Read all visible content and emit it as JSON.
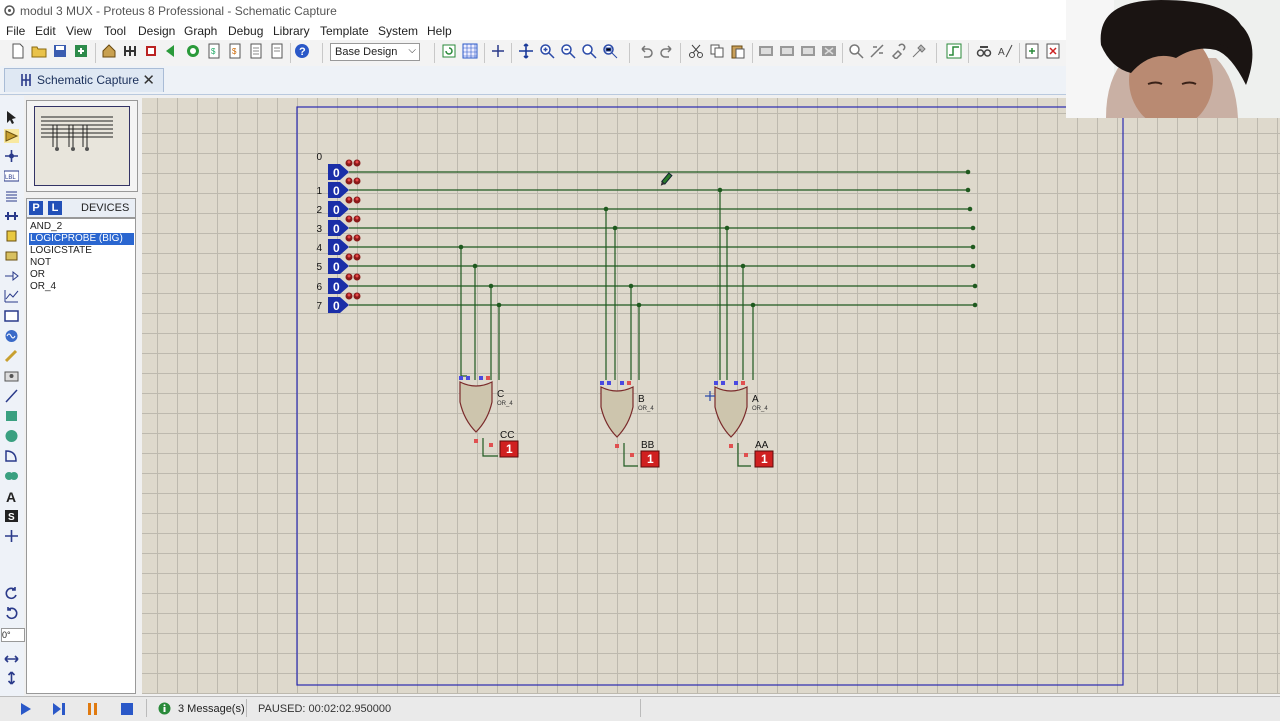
{
  "window": {
    "title": "modul 3 MUX - Proteus 8 Professional - Schematic Capture"
  },
  "menu": [
    "File",
    "Edit",
    "View",
    "Tool",
    "Design",
    "Graph",
    "Debug",
    "Library",
    "Template",
    "System",
    "Help"
  ],
  "toolbar": {
    "design_select": "Base Design"
  },
  "tab": {
    "label": "Schematic Capture",
    "close": "✕"
  },
  "panel": {
    "p_button": "P",
    "l_button": "L",
    "header": "DEVICES",
    "devices": [
      "AND_2",
      "LOGICPROBE (BIG)",
      "LOGICSTATE",
      "NOT",
      "OR",
      "OR_4"
    ],
    "selected_device": "LOGICPROBE (BIG)"
  },
  "rotation": "0°",
  "schematic": {
    "inputs": [
      {
        "label": "0",
        "state": "0"
      },
      {
        "label": "1",
        "state": "0"
      },
      {
        "label": "2",
        "state": "0"
      },
      {
        "label": "3",
        "state": "0"
      },
      {
        "label": "4",
        "state": "0"
      },
      {
        "label": "5",
        "state": "0"
      },
      {
        "label": "6",
        "state": "0"
      },
      {
        "label": "7",
        "state": "0"
      }
    ],
    "gates": [
      {
        "name": "C",
        "type": "OR_4",
        "probe": "CC",
        "value": "1"
      },
      {
        "name": "B",
        "type": "OR_4",
        "probe": "BB",
        "value": "1"
      },
      {
        "name": "A",
        "type": "OR_4",
        "probe": "AA",
        "value": "1"
      }
    ]
  },
  "status": {
    "messages": "3 Message(s)",
    "sim": "PAUSED: 00:02:02.950000"
  },
  "colors": {
    "canvas": "#ded9cc",
    "wire": "#1f5a1f",
    "logicstate": "#1a2ea8",
    "probe": "#d02020",
    "gate": "#cdc5ad"
  }
}
